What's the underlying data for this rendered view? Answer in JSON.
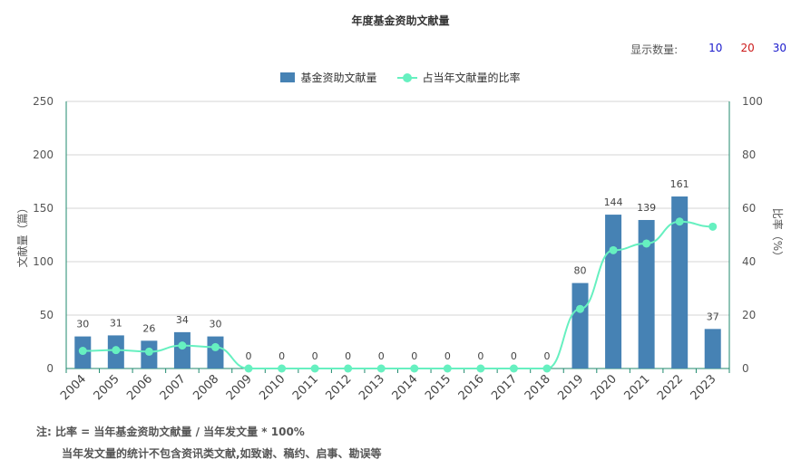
{
  "title": "年度基金资助文献量",
  "count_selector": {
    "label": "显示数量:",
    "options": [
      {
        "text": "10",
        "color": "#1a1acc"
      },
      {
        "text": "20",
        "color": "#cc1a1a"
      },
      {
        "text": "30",
        "color": "#1a1acc"
      }
    ]
  },
  "legend": {
    "bar_label": "基金资助文献量",
    "line_label": "占当年文献量的比率"
  },
  "colors": {
    "bar": "#4682b4",
    "line": "#66f0c0",
    "axis": "#1f8a6e"
  },
  "chart_data": {
    "type": "bar",
    "categories": [
      "2004",
      "2005",
      "2006",
      "2007",
      "2008",
      "2009",
      "2010",
      "2011",
      "2012",
      "2013",
      "2014",
      "2015",
      "2016",
      "2017",
      "2018",
      "2019",
      "2020",
      "2021",
      "2022",
      "2023"
    ],
    "series": [
      {
        "name": "基金资助文献量",
        "type": "bar",
        "axis": "left",
        "values": [
          30,
          31,
          26,
          34,
          30,
          0,
          0,
          0,
          0,
          0,
          0,
          0,
          0,
          0,
          0,
          80,
          144,
          139,
          161,
          37
        ]
      },
      {
        "name": "占当年文献量的比率",
        "type": "line",
        "axis": "right",
        "values": [
          6.6,
          6.9,
          6.3,
          8.6,
          8.0,
          0,
          0,
          0,
          0,
          0,
          0,
          0,
          0,
          0,
          0,
          22.3,
          44.3,
          46.8,
          55.0,
          53.1
        ]
      }
    ],
    "ylabel": "文献量（篇）",
    "ylim": [
      0,
      250
    ],
    "yticks": [
      0,
      50,
      100,
      150,
      200,
      250
    ],
    "y2label": "比率（%）",
    "y2lim": [
      0,
      100
    ],
    "y2ticks": [
      0,
      20,
      40,
      60,
      80,
      100
    ],
    "grid": true,
    "legend_position": "top-center"
  },
  "notes": {
    "line1": "注:  比率 = 当年基金资助文献量 / 当年发文量 * 100%",
    "line2": "当年发文量的统计不包含资讯类文献,如致谢、稿约、启事、勘误等"
  }
}
